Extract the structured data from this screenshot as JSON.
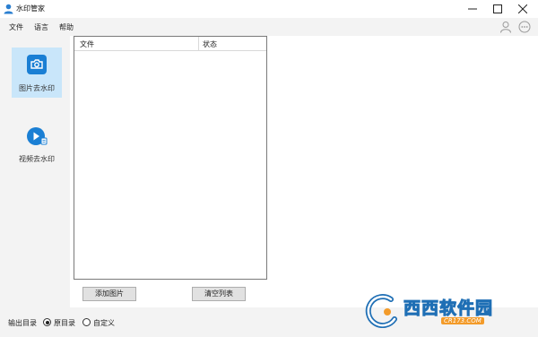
{
  "window": {
    "title": "水印管家"
  },
  "menu": {
    "file": "文件",
    "language": "语言",
    "help": "帮助"
  },
  "sidebar": {
    "items": [
      {
        "label": "图片去水印",
        "icon": "image-watermark-icon",
        "active": true
      },
      {
        "label": "视频去水印",
        "icon": "video-watermark-icon",
        "active": false
      }
    ]
  },
  "file_list": {
    "columns": [
      "文件",
      "状态"
    ],
    "rows": []
  },
  "buttons": {
    "add_image": "添加图片",
    "clear_list": "清空列表"
  },
  "footer": {
    "output_label": "输出目录",
    "options": [
      {
        "label": "原目录",
        "checked": true
      },
      {
        "label": "自定义",
        "checked": false
      }
    ]
  },
  "watermark": {
    "brand": "西西软件园",
    "site": "CR173.COM"
  },
  "colors": {
    "accent": "#1a7fd4",
    "sidebar_active": "#c9e6fa"
  }
}
